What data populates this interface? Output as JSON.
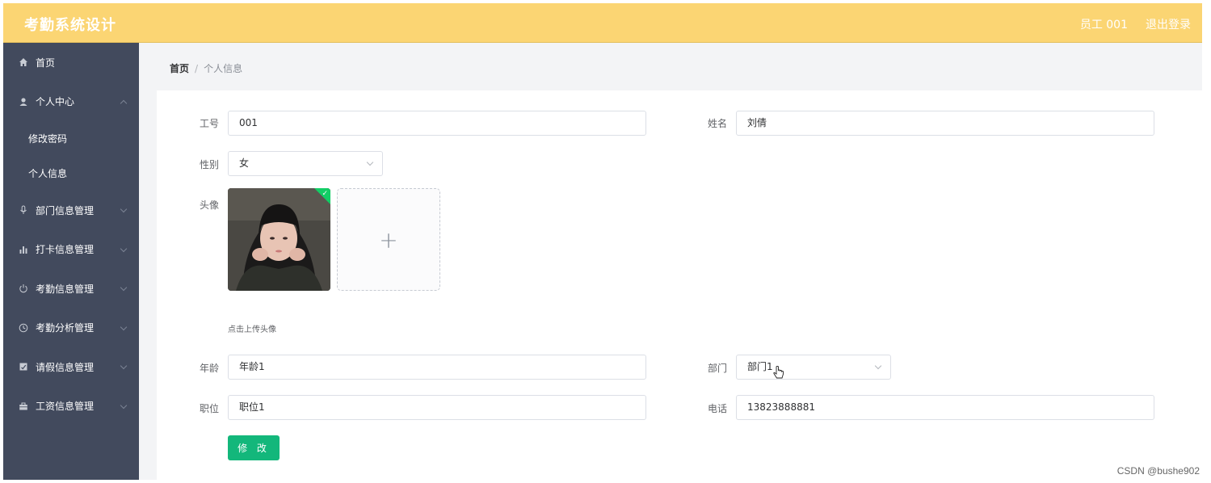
{
  "header": {
    "title": "考勤系统设计",
    "user": "员工 001",
    "logout": "退出登录"
  },
  "sidebar": {
    "items": [
      {
        "label": "首页",
        "icon": "home-icon"
      },
      {
        "label": "个人中心",
        "icon": "user-icon",
        "expanded": true,
        "children": [
          {
            "label": "修改密码"
          },
          {
            "label": "个人信息"
          }
        ]
      },
      {
        "label": "部门信息管理",
        "icon": "mic-icon"
      },
      {
        "label": "打卡信息管理",
        "icon": "bar-chart-icon"
      },
      {
        "label": "考勤信息管理",
        "icon": "power-icon"
      },
      {
        "label": "考勤分析管理",
        "icon": "clock-icon"
      },
      {
        "label": "请假信息管理",
        "icon": "note-icon"
      },
      {
        "label": "工资信息管理",
        "icon": "briefcase-icon"
      }
    ]
  },
  "breadcrumb": {
    "home": "首页",
    "separator": "/",
    "current": "个人信息"
  },
  "form": {
    "job_no": {
      "label": "工号",
      "value": "001"
    },
    "name": {
      "label": "姓名",
      "value": "刘倩"
    },
    "gender": {
      "label": "性别",
      "value": "女"
    },
    "avatar": {
      "label": "头像",
      "hint": "点击上传头像"
    },
    "age": {
      "label": "年龄",
      "value": "年龄1"
    },
    "dept": {
      "label": "部门",
      "value": "部门1"
    },
    "position": {
      "label": "职位",
      "value": "职位1"
    },
    "phone": {
      "label": "电话",
      "value": "13823888881"
    },
    "submit": "修 改"
  },
  "watermark": "CSDN @bushe902",
  "colors": {
    "header": "#fbd573",
    "sidebar": "#424a5d",
    "button": "#13b77b"
  }
}
